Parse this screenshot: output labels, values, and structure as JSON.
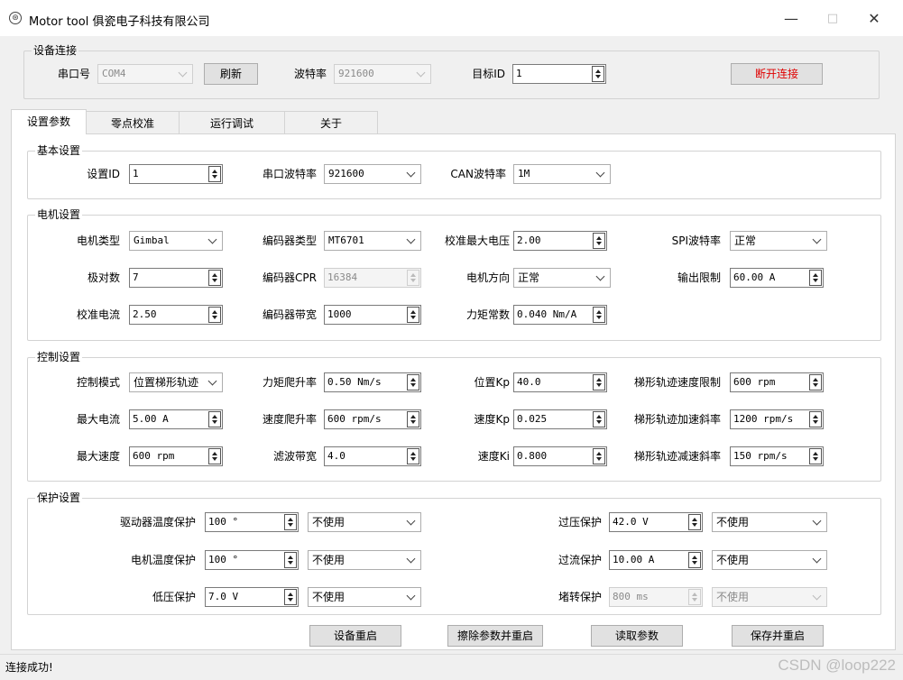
{
  "window": {
    "title": "Motor tool  俱瓷电子科技有限公司",
    "app_icon": "motor-icon",
    "minimize": "—",
    "maximize": "□",
    "close": "✕"
  },
  "connection": {
    "group_title": "设备连接",
    "port_label": "串口号",
    "port_value": "COM4",
    "refresh_label": "刷新",
    "baud_label": "波特率",
    "baud_value": "921600",
    "target_id_label": "目标ID",
    "target_id_value": "1",
    "disconnect_label": "断开连接",
    "disconnect_color": "#e00000"
  },
  "tabs": [
    {
      "label": "设置参数",
      "active": true
    },
    {
      "label": "零点校准",
      "active": false
    },
    {
      "label": "运行调试",
      "active": false
    },
    {
      "label": "关于",
      "active": false
    }
  ],
  "basic": {
    "group_title": "基本设置",
    "id_label": "设置ID",
    "id_value": "1",
    "serial_baud_label": "串口波特率",
    "serial_baud_value": "921600",
    "can_baud_label": "CAN波特率",
    "can_baud_value": "1M"
  },
  "motor": {
    "group_title": "电机设置",
    "type_label": "电机类型",
    "type_value": "Gimbal",
    "encoder_type_label": "编码器类型",
    "encoder_type_value": "MT6701",
    "calib_max_voltage_label": "校准最大电压",
    "calib_max_voltage_value": "2.00",
    "spi_baud_label": "SPI波特率",
    "spi_baud_value": "正常",
    "pole_pairs_label": "极对数",
    "pole_pairs_value": "7",
    "encoder_cpr_label": "编码器CPR",
    "encoder_cpr_value": "16384",
    "direction_label": "电机方向",
    "direction_value": "正常",
    "output_limit_label": "输出限制",
    "output_limit_value": "60.00 A",
    "calib_current_label": "校准电流",
    "calib_current_value": "2.50",
    "encoder_bw_label": "编码器带宽",
    "encoder_bw_value": "1000",
    "torque_const_label": "力矩常数",
    "torque_const_value": "0.040 Nm/A"
  },
  "control": {
    "group_title": "控制设置",
    "mode_label": "控制模式",
    "mode_value": "位置梯形轨迹",
    "torque_ramp_label": "力矩爬升率",
    "torque_ramp_value": "0.50 Nm/s",
    "pos_kp_label": "位置Kp",
    "pos_kp_value": "40.0",
    "traj_vel_limit_label": "梯形轨迹速度限制",
    "traj_vel_limit_value": "600 rpm",
    "max_current_label": "最大电流",
    "max_current_value": "5.00 A",
    "vel_ramp_label": "速度爬升率",
    "vel_ramp_value": "600 rpm/s",
    "vel_kp_label": "速度Kp",
    "vel_kp_value": "0.025",
    "traj_accel_label": "梯形轨迹加速斜率",
    "traj_accel_value": "1200 rpm/s",
    "max_speed_label": "最大速度",
    "max_speed_value": "600 rpm",
    "filter_bw_label": "滤波带宽",
    "filter_bw_value": "4.0",
    "vel_ki_label": "速度Ki",
    "vel_ki_value": "0.800",
    "traj_decel_label": "梯形轨迹减速斜率",
    "traj_decel_value": "150 rpm/s"
  },
  "protection": {
    "group_title": "保护设置",
    "driver_temp_label": "驱动器温度保护",
    "driver_temp_value": "100 °",
    "driver_temp_mode": "不使用",
    "overvoltage_label": "过压保护",
    "overvoltage_value": "42.0 V",
    "overvoltage_mode": "不使用",
    "motor_temp_label": "电机温度保护",
    "motor_temp_value": "100 °",
    "motor_temp_mode": "不使用",
    "overcurrent_label": "过流保护",
    "overcurrent_value": "10.00 A",
    "overcurrent_mode": "不使用",
    "undervoltage_label": "低压保护",
    "undervoltage_value": "7.0 V",
    "undervoltage_mode": "不使用",
    "stall_label": "堵转保护",
    "stall_value": "800 ms",
    "stall_mode": "不使用"
  },
  "actions": {
    "reboot": "设备重启",
    "erase_reboot": "擦除参数并重启",
    "read_params": "读取参数",
    "save_reboot": "保存并重启"
  },
  "status": {
    "text": "连接成功!",
    "watermark": "CSDN @loop222"
  }
}
